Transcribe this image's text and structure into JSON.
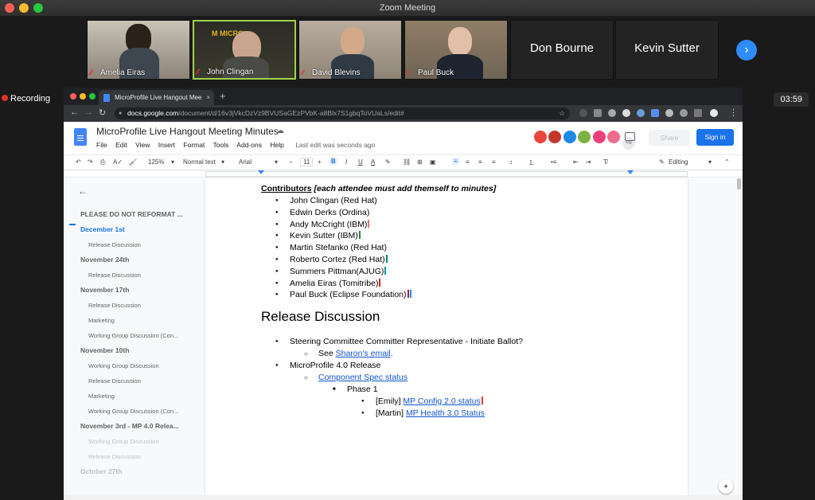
{
  "zoom": {
    "window_title": "Zoom Meeting",
    "participants": [
      {
        "name": "Amelia Eiras",
        "type": "video",
        "bg": "#8d8378"
      },
      {
        "name": "John Clingan",
        "type": "video",
        "bg": "#3a3a2e",
        "active": true
      },
      {
        "name": "David Blevins",
        "type": "video",
        "bg": "#8f8577"
      },
      {
        "name": "Paul Buck",
        "type": "video",
        "bg": "#6f6455"
      },
      {
        "name": "Don Bourne",
        "type": "text"
      },
      {
        "name": "Kevin Sutter",
        "type": "text"
      }
    ],
    "next_icon": "chevron-right-icon",
    "recording_label": "Recording",
    "timer": "03:59"
  },
  "chrome": {
    "tab_title": "MicroProfile Live Hangout Mee",
    "tab_close": "×",
    "new_tab": "+",
    "url_host": "docs.google.com",
    "url_path": "/document/d/16v3jVkcDzVz9BVUSaGEzPVbK-a8Blx7S1gbqToVUaLs/edit#"
  },
  "docs": {
    "title": "MicroProfile Live Hangout Meeting Minutes",
    "menu": [
      "File",
      "Edit",
      "View",
      "Insert",
      "Format",
      "Tools",
      "Add-ons",
      "Help"
    ],
    "last_edit": "Last edit was seconds ago",
    "avatars": [
      "#e8453c",
      "#c0392b",
      "#1e88e5",
      "#7cb342",
      "#ec407a",
      "#ef6c8f"
    ],
    "avatars_more": "+8",
    "share_label": "Share",
    "signin_label": "Sign in",
    "toolbar": {
      "zoom": "125%",
      "style": "Normal text",
      "font": "Arial",
      "size": "11",
      "editing": "Editing"
    },
    "outline": [
      {
        "text": "PLEASE DO NOT REFORMAT ...",
        "level": "h"
      },
      {
        "text": "December 1st",
        "level": "h",
        "active": true
      },
      {
        "text": "Release Discussion",
        "level": "sub"
      },
      {
        "text": "November 24th",
        "level": "h"
      },
      {
        "text": "Release Discussion",
        "level": "sub"
      },
      {
        "text": "November 17th",
        "level": "h"
      },
      {
        "text": "Release Discussion",
        "level": "sub"
      },
      {
        "text": "Marketing",
        "level": "sub"
      },
      {
        "text": "Working Group Discussion (Con...",
        "level": "sub"
      },
      {
        "text": "November 10th",
        "level": "h"
      },
      {
        "text": "Working Group Discussion",
        "level": "sub"
      },
      {
        "text": "Release Discussion",
        "level": "sub"
      },
      {
        "text": "Marketing",
        "level": "sub"
      },
      {
        "text": "Working Group Discussion (Con...",
        "level": "sub"
      },
      {
        "text": "November 3rd - MP 4.0 Relea...",
        "level": "h"
      },
      {
        "text": "Working Group Discussion",
        "level": "sub",
        "faded": true
      },
      {
        "text": "Release Discussion",
        "level": "sub",
        "faded": true
      },
      {
        "text": "October 27th",
        "level": "h",
        "faded": true
      }
    ],
    "contributors_heading": "Contributors",
    "contributors_note": "[each attendee must add themself to minutes]",
    "contributors": [
      {
        "text": "John Clingan (Red Hat)"
      },
      {
        "text": "Edwin Derks (Ordina)"
      },
      {
        "text": "Andy McCright (IBM)",
        "cursor": "#e57373"
      },
      {
        "text": "Kevin Sutter (IBM)",
        "cursor": "#2e7d32"
      },
      {
        "text": "Martin Stefanko (Red Hat)"
      },
      {
        "text": "Roberto Cortez (Red Hat)",
        "cursor": "#00897b"
      },
      {
        "text": "Summers Pittman(AJUG)",
        "cursor": "#0097a7"
      },
      {
        "text": "Amelia Eiras (Tomitribe)",
        "cursor": "#c62828"
      },
      {
        "text": "Paul Buck (Eclipse Foundation)",
        "cursor": "#ad1457"
      }
    ],
    "section_heading": "Release Discussion",
    "items": {
      "steering": "Steering Committee Committer Representative - Initiate Ballot?",
      "see": "See ",
      "sharon_link": "Sharon's email",
      "period": ".",
      "mp_release": "MicroProfile  4.0 Release",
      "component_link": "Component Spec status",
      "phase": "Phase 1",
      "emily_prefix": "[Emily] ",
      "emily_link": "MP Config 2.0 status",
      "martin_prefix": "[Martin] ",
      "martin_link": "MP Health 3.0 Status"
    }
  }
}
